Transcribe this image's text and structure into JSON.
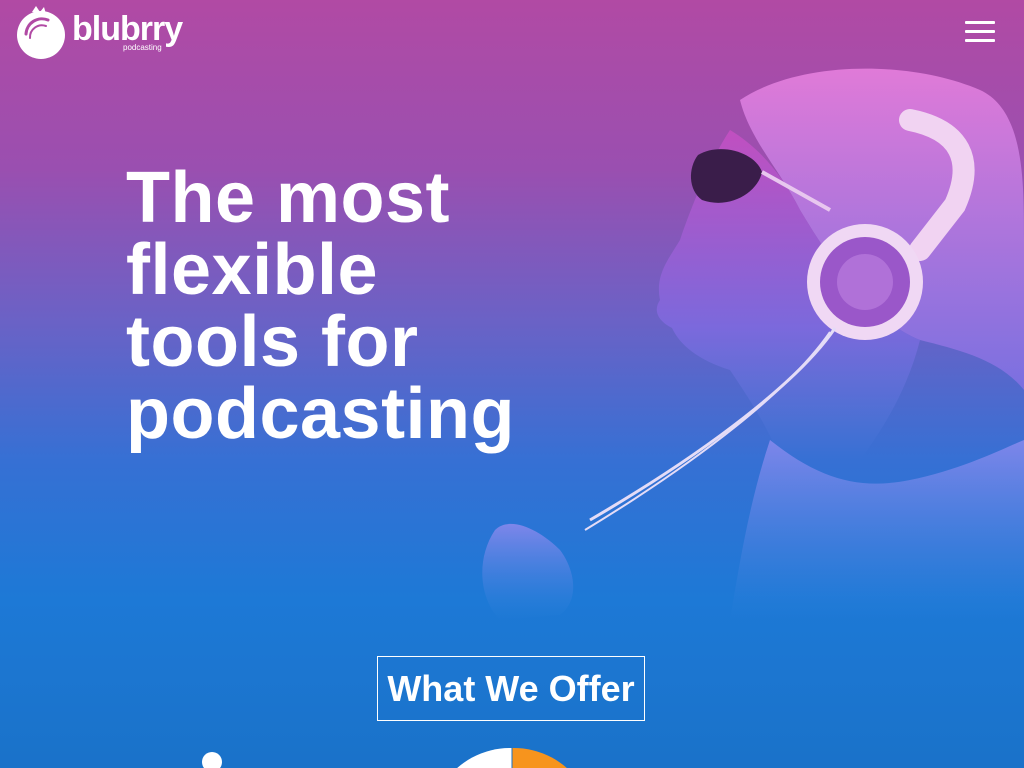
{
  "header": {
    "logo_word": "blubrry",
    "logo_sub": "podcasting"
  },
  "hero": {
    "headline_lines": [
      "The most",
      "flexible",
      "tools for",
      "podcasting"
    ]
  },
  "cta": {
    "label": "What We Offer"
  },
  "icons": {
    "logo": "blubrry-logo-icon",
    "menu": "hamburger-menu-icon",
    "pie": "pie-chart-icon"
  },
  "colors": {
    "gradient_top": "#b14aa4",
    "gradient_bottom": "#1a72c9",
    "accent_orange": "#f7941d",
    "text": "#ffffff"
  }
}
